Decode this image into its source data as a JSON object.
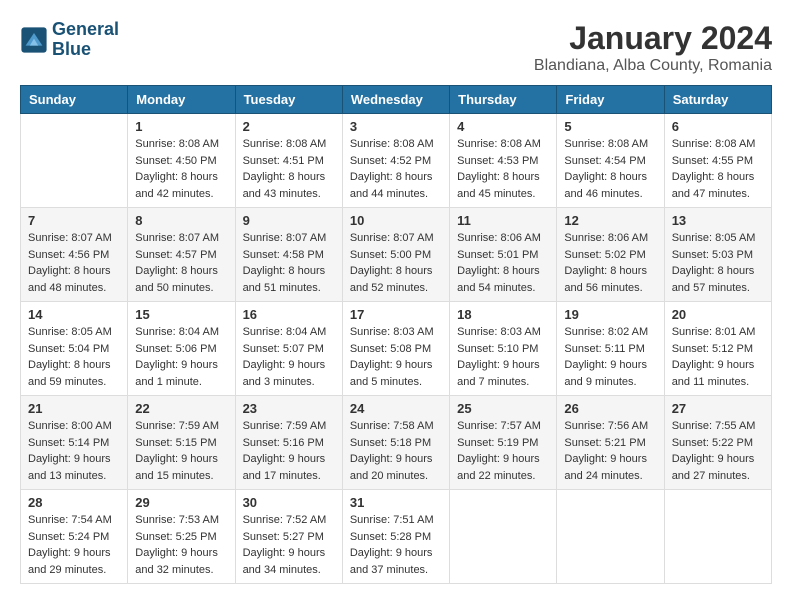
{
  "logo": {
    "line1": "General",
    "line2": "Blue"
  },
  "title": "January 2024",
  "location": "Blandiana, Alba County, Romania",
  "weekdays": [
    "Sunday",
    "Monday",
    "Tuesday",
    "Wednesday",
    "Thursday",
    "Friday",
    "Saturday"
  ],
  "weeks": [
    [
      {
        "day": "",
        "sunrise": "",
        "sunset": "",
        "daylight": ""
      },
      {
        "day": "1",
        "sunrise": "Sunrise: 8:08 AM",
        "sunset": "Sunset: 4:50 PM",
        "daylight": "Daylight: 8 hours and 42 minutes."
      },
      {
        "day": "2",
        "sunrise": "Sunrise: 8:08 AM",
        "sunset": "Sunset: 4:51 PM",
        "daylight": "Daylight: 8 hours and 43 minutes."
      },
      {
        "day": "3",
        "sunrise": "Sunrise: 8:08 AM",
        "sunset": "Sunset: 4:52 PM",
        "daylight": "Daylight: 8 hours and 44 minutes."
      },
      {
        "day": "4",
        "sunrise": "Sunrise: 8:08 AM",
        "sunset": "Sunset: 4:53 PM",
        "daylight": "Daylight: 8 hours and 45 minutes."
      },
      {
        "day": "5",
        "sunrise": "Sunrise: 8:08 AM",
        "sunset": "Sunset: 4:54 PM",
        "daylight": "Daylight: 8 hours and 46 minutes."
      },
      {
        "day": "6",
        "sunrise": "Sunrise: 8:08 AM",
        "sunset": "Sunset: 4:55 PM",
        "daylight": "Daylight: 8 hours and 47 minutes."
      }
    ],
    [
      {
        "day": "7",
        "sunrise": "Sunrise: 8:07 AM",
        "sunset": "Sunset: 4:56 PM",
        "daylight": "Daylight: 8 hours and 48 minutes."
      },
      {
        "day": "8",
        "sunrise": "Sunrise: 8:07 AM",
        "sunset": "Sunset: 4:57 PM",
        "daylight": "Daylight: 8 hours and 50 minutes."
      },
      {
        "day": "9",
        "sunrise": "Sunrise: 8:07 AM",
        "sunset": "Sunset: 4:58 PM",
        "daylight": "Daylight: 8 hours and 51 minutes."
      },
      {
        "day": "10",
        "sunrise": "Sunrise: 8:07 AM",
        "sunset": "Sunset: 5:00 PM",
        "daylight": "Daylight: 8 hours and 52 minutes."
      },
      {
        "day": "11",
        "sunrise": "Sunrise: 8:06 AM",
        "sunset": "Sunset: 5:01 PM",
        "daylight": "Daylight: 8 hours and 54 minutes."
      },
      {
        "day": "12",
        "sunrise": "Sunrise: 8:06 AM",
        "sunset": "Sunset: 5:02 PM",
        "daylight": "Daylight: 8 hours and 56 minutes."
      },
      {
        "day": "13",
        "sunrise": "Sunrise: 8:05 AM",
        "sunset": "Sunset: 5:03 PM",
        "daylight": "Daylight: 8 hours and 57 minutes."
      }
    ],
    [
      {
        "day": "14",
        "sunrise": "Sunrise: 8:05 AM",
        "sunset": "Sunset: 5:04 PM",
        "daylight": "Daylight: 8 hours and 59 minutes."
      },
      {
        "day": "15",
        "sunrise": "Sunrise: 8:04 AM",
        "sunset": "Sunset: 5:06 PM",
        "daylight": "Daylight: 9 hours and 1 minute."
      },
      {
        "day": "16",
        "sunrise": "Sunrise: 8:04 AM",
        "sunset": "Sunset: 5:07 PM",
        "daylight": "Daylight: 9 hours and 3 minutes."
      },
      {
        "day": "17",
        "sunrise": "Sunrise: 8:03 AM",
        "sunset": "Sunset: 5:08 PM",
        "daylight": "Daylight: 9 hours and 5 minutes."
      },
      {
        "day": "18",
        "sunrise": "Sunrise: 8:03 AM",
        "sunset": "Sunset: 5:10 PM",
        "daylight": "Daylight: 9 hours and 7 minutes."
      },
      {
        "day": "19",
        "sunrise": "Sunrise: 8:02 AM",
        "sunset": "Sunset: 5:11 PM",
        "daylight": "Daylight: 9 hours and 9 minutes."
      },
      {
        "day": "20",
        "sunrise": "Sunrise: 8:01 AM",
        "sunset": "Sunset: 5:12 PM",
        "daylight": "Daylight: 9 hours and 11 minutes."
      }
    ],
    [
      {
        "day": "21",
        "sunrise": "Sunrise: 8:00 AM",
        "sunset": "Sunset: 5:14 PM",
        "daylight": "Daylight: 9 hours and 13 minutes."
      },
      {
        "day": "22",
        "sunrise": "Sunrise: 7:59 AM",
        "sunset": "Sunset: 5:15 PM",
        "daylight": "Daylight: 9 hours and 15 minutes."
      },
      {
        "day": "23",
        "sunrise": "Sunrise: 7:59 AM",
        "sunset": "Sunset: 5:16 PM",
        "daylight": "Daylight: 9 hours and 17 minutes."
      },
      {
        "day": "24",
        "sunrise": "Sunrise: 7:58 AM",
        "sunset": "Sunset: 5:18 PM",
        "daylight": "Daylight: 9 hours and 20 minutes."
      },
      {
        "day": "25",
        "sunrise": "Sunrise: 7:57 AM",
        "sunset": "Sunset: 5:19 PM",
        "daylight": "Daylight: 9 hours and 22 minutes."
      },
      {
        "day": "26",
        "sunrise": "Sunrise: 7:56 AM",
        "sunset": "Sunset: 5:21 PM",
        "daylight": "Daylight: 9 hours and 24 minutes."
      },
      {
        "day": "27",
        "sunrise": "Sunrise: 7:55 AM",
        "sunset": "Sunset: 5:22 PM",
        "daylight": "Daylight: 9 hours and 27 minutes."
      }
    ],
    [
      {
        "day": "28",
        "sunrise": "Sunrise: 7:54 AM",
        "sunset": "Sunset: 5:24 PM",
        "daylight": "Daylight: 9 hours and 29 minutes."
      },
      {
        "day": "29",
        "sunrise": "Sunrise: 7:53 AM",
        "sunset": "Sunset: 5:25 PM",
        "daylight": "Daylight: 9 hours and 32 minutes."
      },
      {
        "day": "30",
        "sunrise": "Sunrise: 7:52 AM",
        "sunset": "Sunset: 5:27 PM",
        "daylight": "Daylight: 9 hours and 34 minutes."
      },
      {
        "day": "31",
        "sunrise": "Sunrise: 7:51 AM",
        "sunset": "Sunset: 5:28 PM",
        "daylight": "Daylight: 9 hours and 37 minutes."
      },
      {
        "day": "",
        "sunrise": "",
        "sunset": "",
        "daylight": ""
      },
      {
        "day": "",
        "sunrise": "",
        "sunset": "",
        "daylight": ""
      },
      {
        "day": "",
        "sunrise": "",
        "sunset": "",
        "daylight": ""
      }
    ]
  ]
}
